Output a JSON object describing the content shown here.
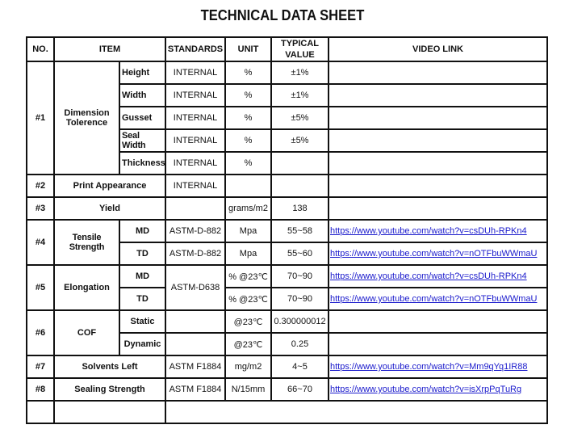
{
  "title": "TECHNICAL DATA SHEET",
  "headers": {
    "no": "NO.",
    "item": "ITEM",
    "standards": "STANDARDS",
    "unit": "UNIT",
    "typical_value_line1": "TYPICAL",
    "typical_value_line2": "VALUE",
    "video_link": "VIDEO LINK"
  },
  "rows": {
    "r1": {
      "no": "#1",
      "item": "Dimension Tolerence",
      "sub": [
        {
          "name": "Height",
          "standard": "INTERNAL",
          "unit": "%",
          "value": "±1%",
          "link": ""
        },
        {
          "name": "Width",
          "standard": "INTERNAL",
          "unit": "%",
          "value": "±1%",
          "link": ""
        },
        {
          "name": "Gusset",
          "standard": "INTERNAL",
          "unit": "%",
          "value": "±5%",
          "link": ""
        },
        {
          "name": "Seal Width",
          "standard": "INTERNAL",
          "unit": "%",
          "value": "±5%",
          "link": ""
        },
        {
          "name": "Thickness",
          "standard": "INTERNAL",
          "unit": "%",
          "value": "",
          "link": ""
        }
      ]
    },
    "r2": {
      "no": "#2",
      "item": "Print Appearance",
      "standard": "INTERNAL",
      "unit": "",
      "value": "",
      "link": ""
    },
    "r3": {
      "no": "#3",
      "item": "Yield",
      "standard": "",
      "unit": "grams/m2",
      "value": "138",
      "link": ""
    },
    "r4": {
      "no": "#4",
      "item": "Tensile Strength",
      "sub": [
        {
          "name": "MD",
          "standard": "ASTM-D-882",
          "unit": "Mpa",
          "value": "55~58",
          "link": "https://www.youtube.com/watch?v=csDUh-RPKn4"
        },
        {
          "name": "TD",
          "standard": "ASTM-D-882",
          "unit": "Mpa",
          "value": "55~60",
          "link": "https://www.youtube.com/watch?v=nOTFbuWWmaU"
        }
      ]
    },
    "r5": {
      "no": "#5",
      "item": "Elongation",
      "standard": "ASTM-D638",
      "sub": [
        {
          "name": "MD",
          "unit": "% @23℃",
          "value": "70~90",
          "link": "https://www.youtube.com/watch?v=csDUh-RPKn4"
        },
        {
          "name": "TD",
          "unit": "% @23℃",
          "value": "70~90",
          "link": "https://www.youtube.com/watch?v=nOTFbuWWmaU"
        }
      ]
    },
    "r6": {
      "no": "#6",
      "item": "COF",
      "sub": [
        {
          "name": "Static",
          "standard": "",
          "unit": "@23℃",
          "value": "0.300000012",
          "link": ""
        },
        {
          "name": "Dynamic",
          "standard": "",
          "unit": "@23℃",
          "value": "0.25",
          "link": ""
        }
      ]
    },
    "r7": {
      "no": "#7",
      "item": "Solvents Left",
      "standard": "ASTM F1884",
      "unit": "mg/m2",
      "value": "4~5",
      "link": "https://www.youtube.com/watch?v=Mm9qYq1IR88"
    },
    "r8": {
      "no": "#8",
      "item": "Sealing Strength",
      "standard": "ASTM F1884",
      "unit": "N/15mm",
      "value": "66~70",
      "link": "https://www.youtube.com/watch?v=isXrpPqTuRg"
    }
  }
}
